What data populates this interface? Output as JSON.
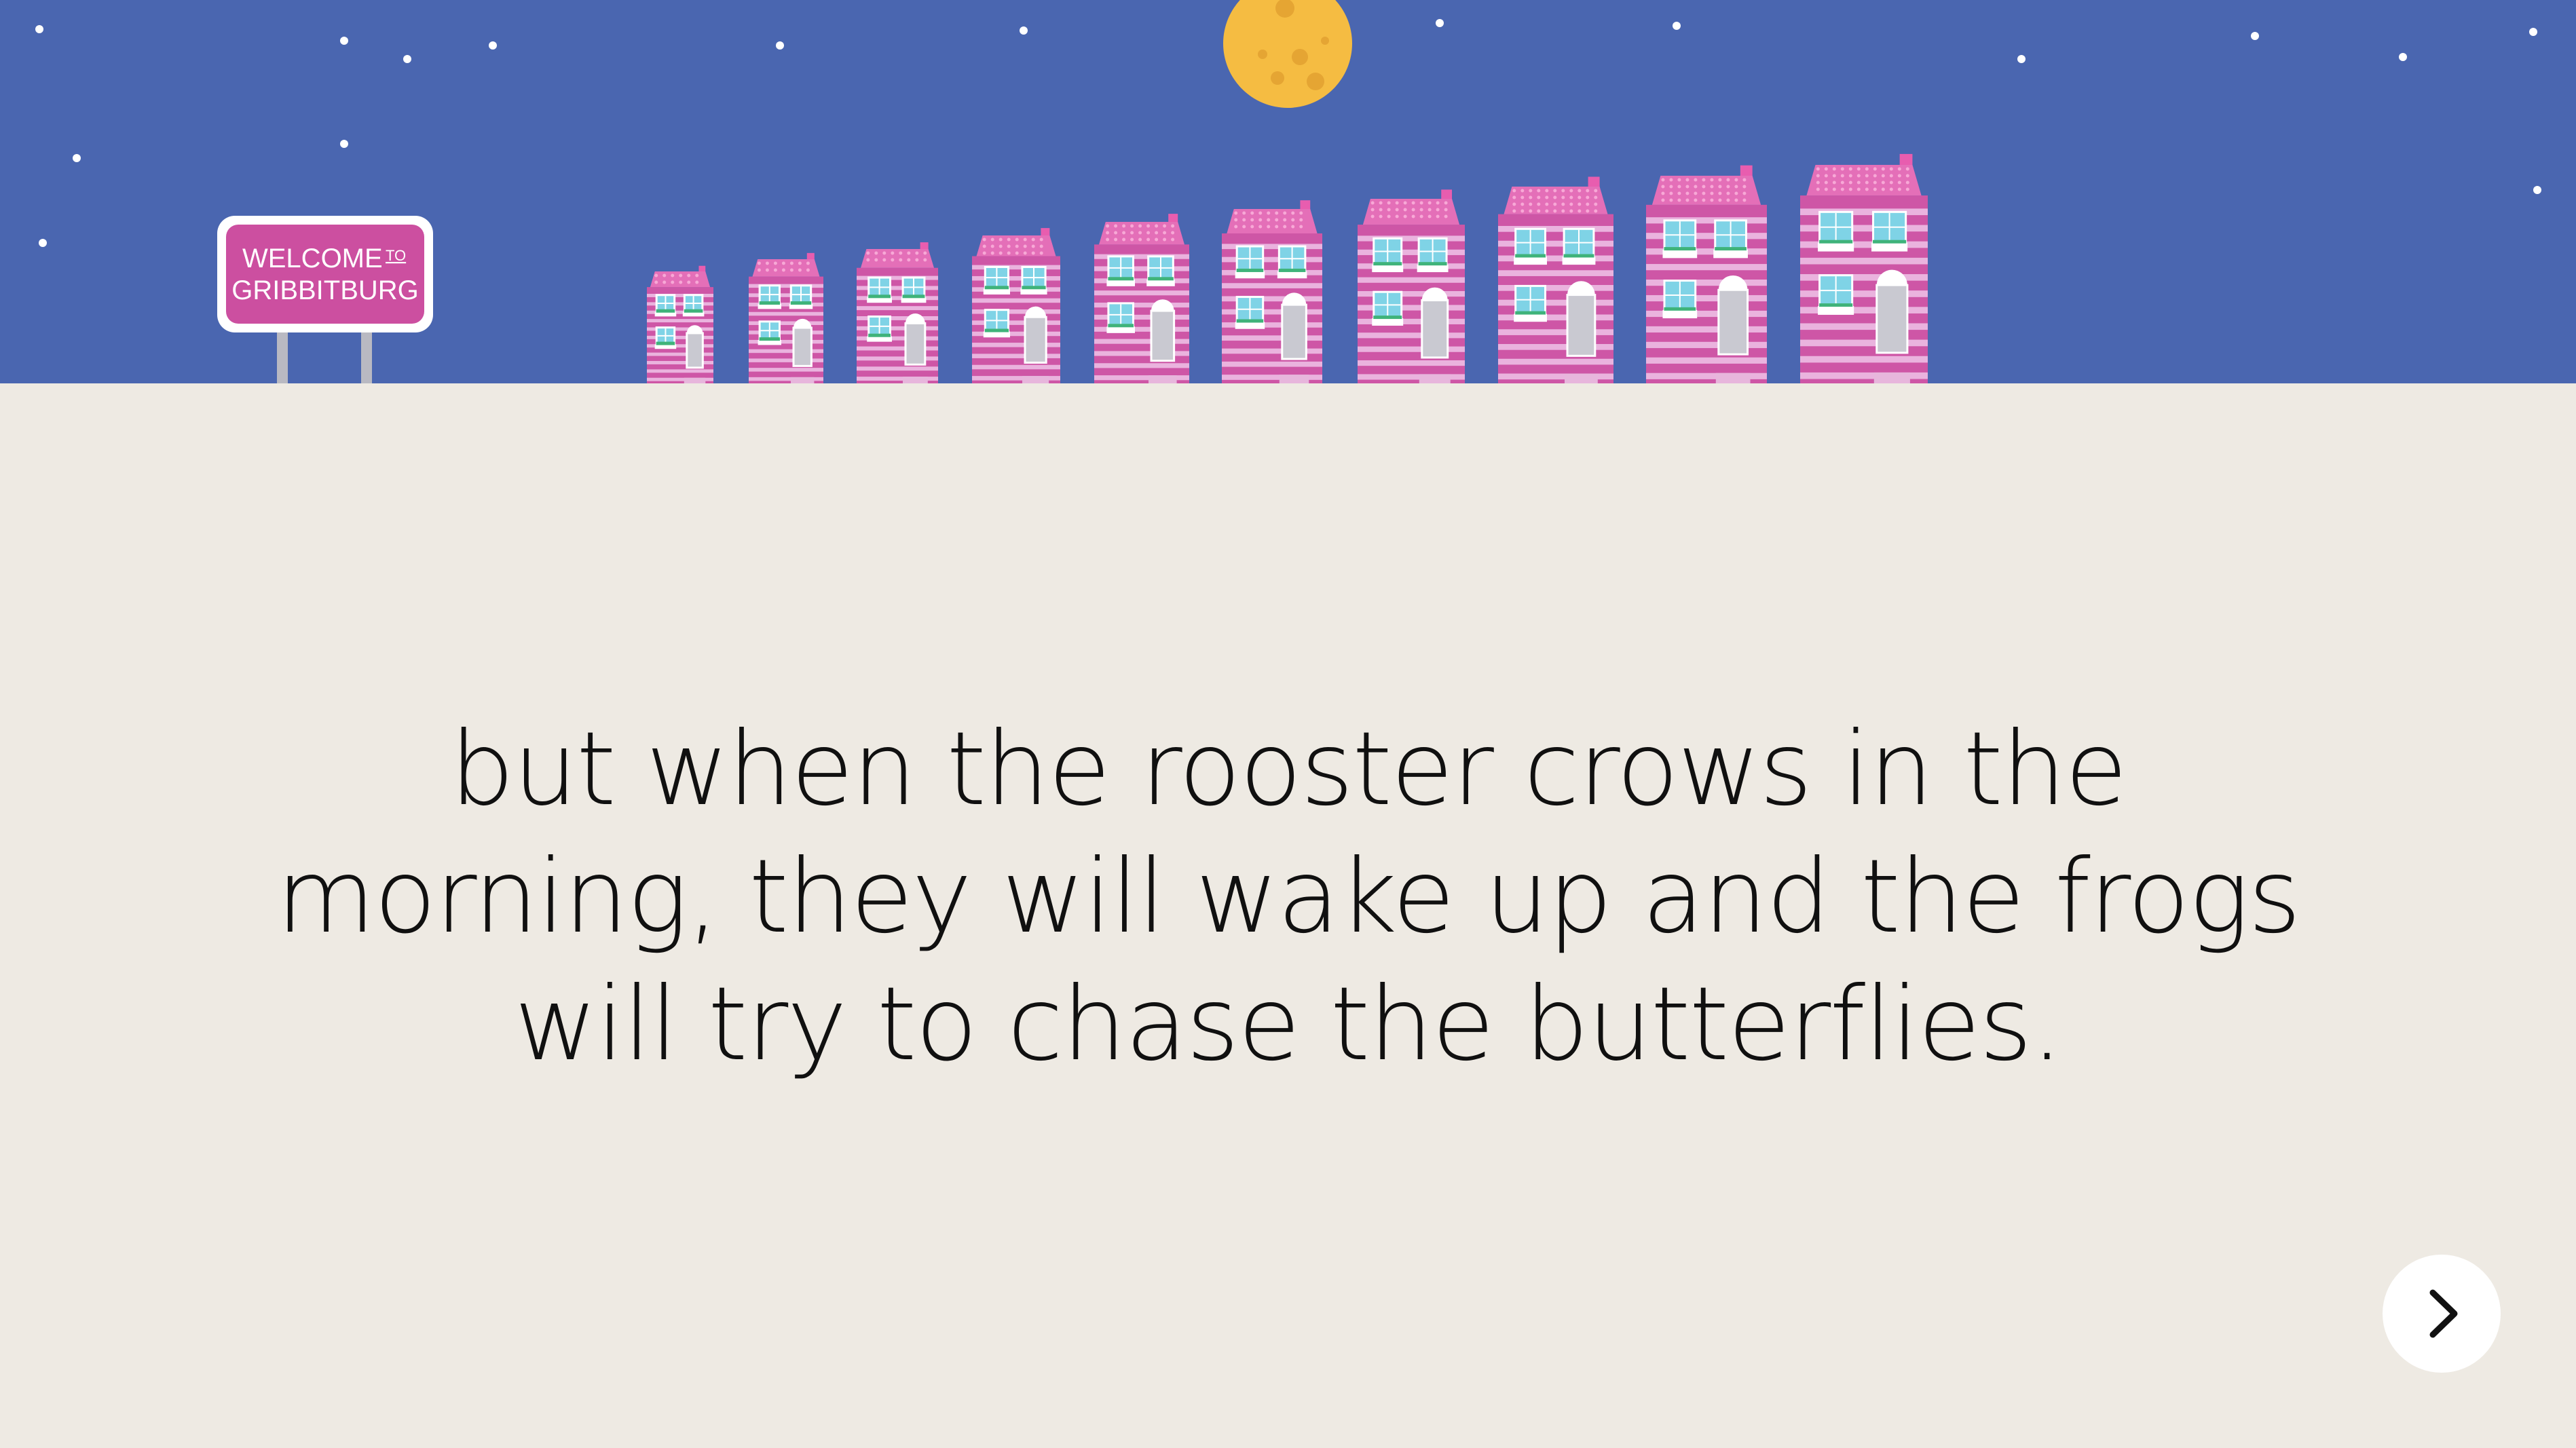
{
  "scene": {
    "sky_color": "#4A66B0",
    "moon_color": "#F5BC42",
    "house_color": "#CE56A6",
    "roof_color": "#E46FB8",
    "window_color": "#7FD3E6",
    "sign": {
      "line1": "WELCOME",
      "small": "TO",
      "line2": "GRIBBITBURG",
      "color": "#CC4FA0"
    }
  },
  "story": {
    "text": "but when the rooster crows in the morning, they will wake up and the frogs will try to chase the butterflies."
  },
  "navigation": {
    "next_icon": "chevron-right-icon"
  }
}
